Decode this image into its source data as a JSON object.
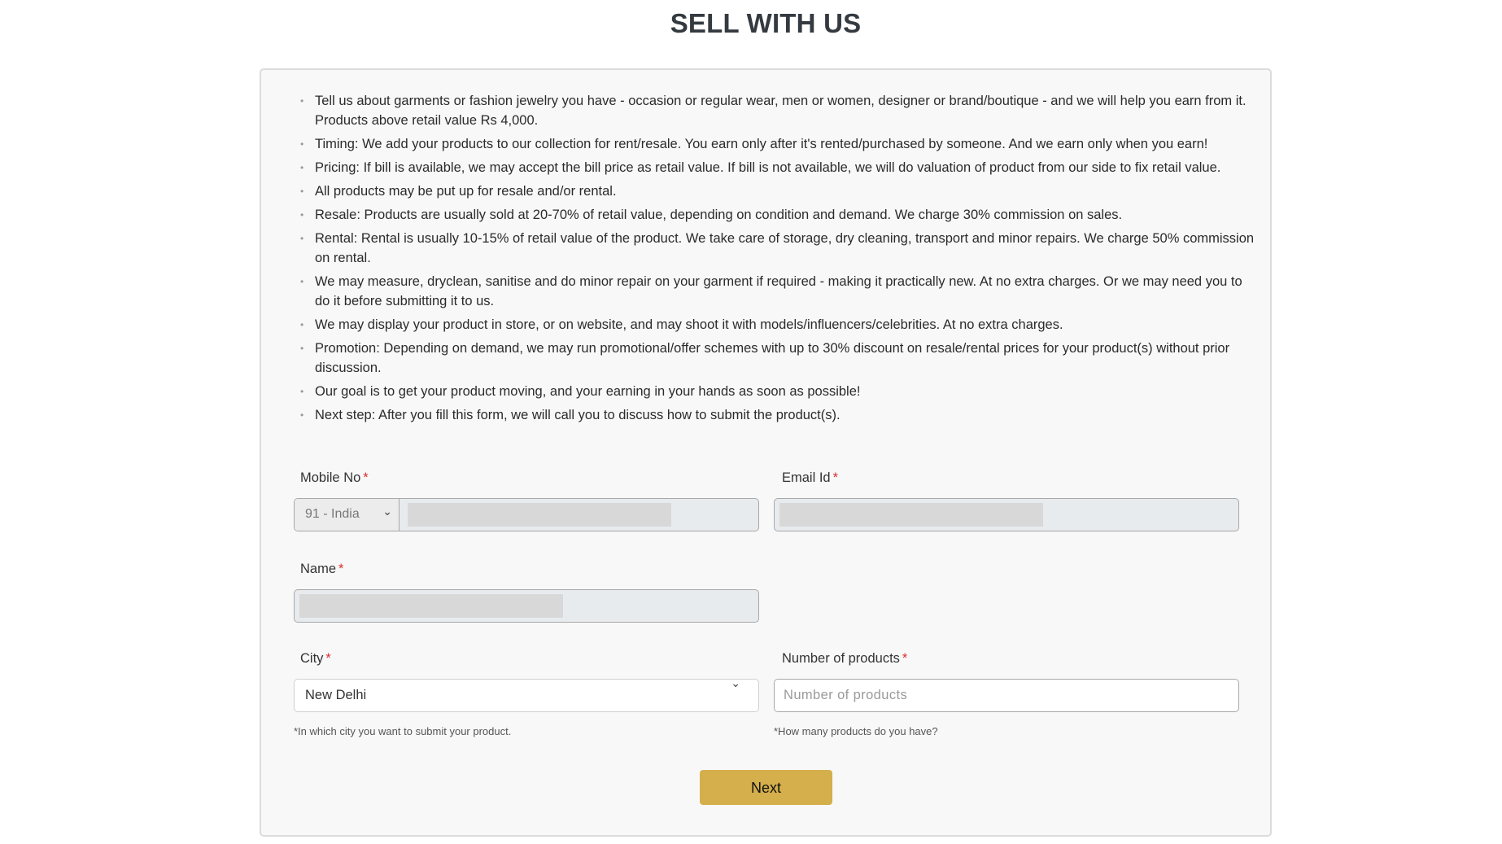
{
  "page": {
    "title": "SELL WITH US"
  },
  "info": {
    "items": [
      "Tell us about garments or fashion jewelry you have - occasion or regular wear, men or women, designer or brand/boutique - and we will help you earn from it. Products above retail value Rs 4,000.",
      "Timing: We add your products to our collection for rent/resale. You earn only after it's rented/purchased by someone. And we earn only when you earn!",
      "Pricing: If bill is available, we may accept the bill price as retail value. If bill is not available, we will do valuation of product from our side to fix retail value.",
      "All products may be put up for resale and/or rental.",
      "Resale: Products are usually sold at 20-70% of retail value, depending on condition and demand. We charge 30% commission on sales.",
      "Rental: Rental is usually 10-15% of retail value of the product. We take care of storage, dry cleaning, transport and minor repairs. We charge 50% commission on rental.",
      "We may measure, dryclean, sanitise and do minor repair on your garment if required - making it practically new. At no extra charges. Or we may need you to do it before submitting it to us.",
      "We may display your product in store, or on website, and may shoot it with models/influencers/celebrities. At no extra charges.",
      "Promotion: Depending on demand, we may run promotional/offer schemes with up to 30% discount on resale/rental prices for your product(s) without prior discussion.",
      "Our goal is to get your product moving, and your earning in your hands as soon as possible!",
      "Next step: After you fill this form, we will call you to discuss how to submit the product(s)."
    ]
  },
  "form": {
    "mobile": {
      "label": "Mobile No",
      "required_mark": "*",
      "country_code": "91 - India"
    },
    "email": {
      "label": "Email Id",
      "required_mark": "*"
    },
    "name": {
      "label": "Name",
      "required_mark": "*"
    },
    "city": {
      "label": "City",
      "required_mark": "*",
      "value": "New Delhi",
      "hint": "*In which city you want to submit your product."
    },
    "products": {
      "label": "Number of products",
      "required_mark": "*",
      "placeholder": "Number of products",
      "hint": "*How many products do you have?"
    },
    "next_label": "Next"
  },
  "icons": {
    "chevron": "⌄",
    "bullet": "•"
  },
  "colors": {
    "button": "#d4af4b",
    "required": "#d9302c"
  }
}
